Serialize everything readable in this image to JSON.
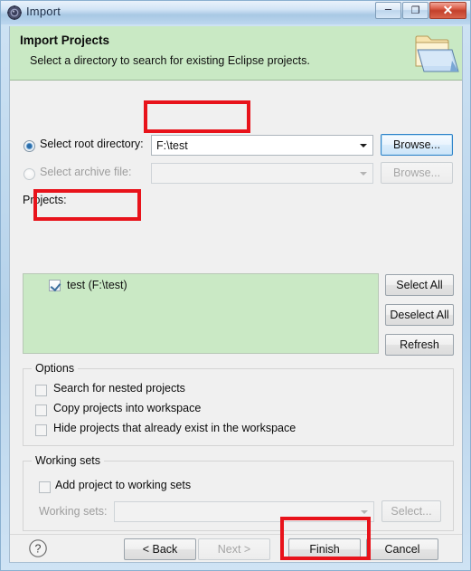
{
  "window": {
    "title": "Import",
    "title_icon": "eclipse-import-icon",
    "controls": {
      "minimize": "–",
      "maximize": "❐",
      "close": "✕"
    }
  },
  "header": {
    "title": "Import Projects",
    "description": "Select a directory to search for existing Eclipse projects.",
    "icon": "open-folder-icon",
    "background_color": "#c9e9c4"
  },
  "source": {
    "root_directory": {
      "radio_label": "Select root directory:",
      "selected": true,
      "value": "F:\\test",
      "placeholder": "",
      "browse_label": "Browse...",
      "browse_focused": true
    },
    "archive_file": {
      "radio_label": "Select archive file:",
      "selected": false,
      "value": "",
      "placeholder": "",
      "browse_label": "Browse...",
      "enabled": false
    }
  },
  "projects": {
    "label": "Projects:",
    "background_color": "#cae9c5",
    "items": [
      {
        "label": "test (F:\\test)",
        "checked": true
      }
    ],
    "buttons": {
      "select_all": "Select All",
      "deselect_all": "Deselect All",
      "refresh": "Refresh"
    }
  },
  "options": {
    "group_title": "Options",
    "checkboxes": [
      {
        "label": "Search for nested projects",
        "checked": false
      },
      {
        "label": "Copy projects into workspace",
        "checked": false
      },
      {
        "label": "Hide projects that already exist in the workspace",
        "checked": false
      }
    ]
  },
  "working_sets": {
    "group_title": "Working sets",
    "add_checkbox": {
      "label": "Add project to working sets",
      "checked": false
    },
    "combo_label": "Working sets:",
    "combo_value": "",
    "combo_enabled": false,
    "select_label": "Select...",
    "select_enabled": false
  },
  "footer": {
    "help_icon": "help-question-icon",
    "buttons": [
      {
        "name": "back",
        "label": "< Back",
        "enabled": true
      },
      {
        "name": "next",
        "label": "Next >",
        "enabled": false
      },
      {
        "name": "finish",
        "label": "Finish",
        "enabled": true
      },
      {
        "name": "cancel",
        "label": "Cancel",
        "enabled": true
      }
    ]
  },
  "annotations": {
    "color": "#e8131b",
    "boxes": [
      {
        "name": "root-directory-highlight"
      },
      {
        "name": "project-item-highlight"
      },
      {
        "name": "finish-button-highlight"
      }
    ]
  }
}
